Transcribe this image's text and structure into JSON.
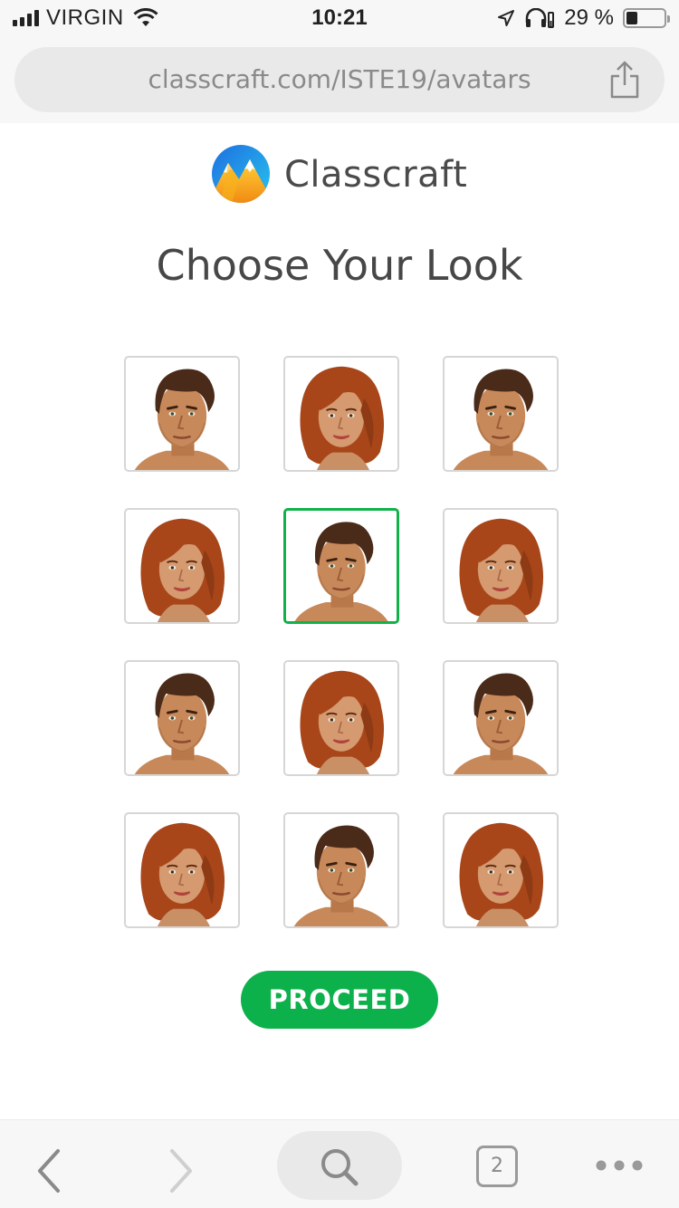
{
  "status_bar": {
    "carrier": "VIRGIN",
    "time": "10:21",
    "battery": "29 %",
    "battery_level": 0.29
  },
  "browser": {
    "url": "classcraft.com/ISTE19/avatars",
    "tab_count": "2"
  },
  "page": {
    "brand": "Classcraft",
    "title": "Choose Your Look",
    "proceed_label": "PROCEED"
  },
  "avatars": [
    {
      "gender": "male",
      "selected": false
    },
    {
      "gender": "female",
      "selected": false
    },
    {
      "gender": "male",
      "selected": false
    },
    {
      "gender": "female",
      "selected": false
    },
    {
      "gender": "male",
      "selected": true
    },
    {
      "gender": "female",
      "selected": false
    },
    {
      "gender": "male",
      "selected": false
    },
    {
      "gender": "female",
      "selected": false
    },
    {
      "gender": "male",
      "selected": false
    },
    {
      "gender": "female",
      "selected": false
    },
    {
      "gender": "male",
      "selected": false
    },
    {
      "gender": "female",
      "selected": false
    }
  ],
  "colors": {
    "accent": "#0db14b",
    "selected_border": "#12b24a",
    "male_hair": "#4a2a18",
    "female_hair": "#a8461a",
    "skin": "#c8895a"
  }
}
